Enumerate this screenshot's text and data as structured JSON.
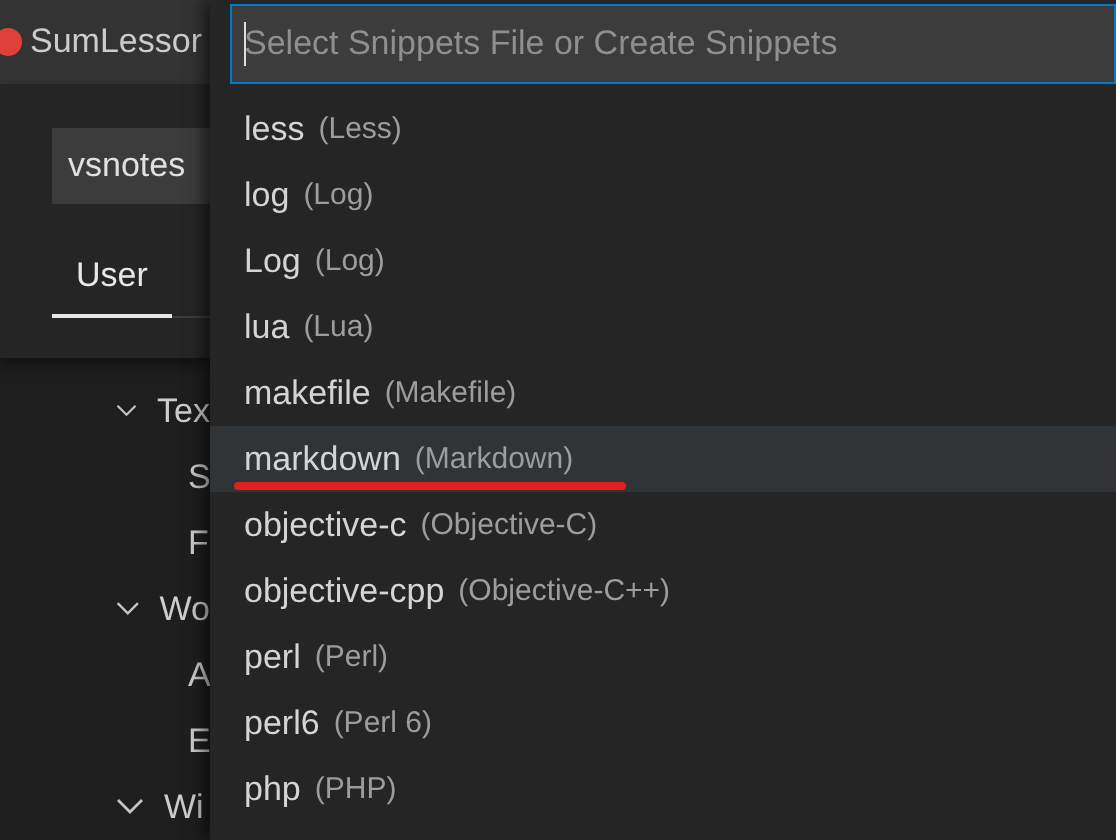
{
  "title_bar": {
    "title": "SumLessor"
  },
  "settings": {
    "search": {
      "value": "vsnotes"
    },
    "tabs": [
      {
        "label": "User",
        "selected": true
      }
    ],
    "tree": [
      {
        "label": "Tex",
        "expanded": true,
        "children": [
          {
            "label": "S"
          },
          {
            "label": "F"
          }
        ]
      },
      {
        "label": "Wo",
        "expanded": true,
        "children": [
          {
            "label": "A"
          },
          {
            "label": "E"
          }
        ]
      },
      {
        "label": "Wi",
        "expanded": true
      }
    ]
  },
  "quick_pick": {
    "placeholder": "Select Snippets File or Create Snippets",
    "items": [
      {
        "label": "less",
        "description": "(Less)",
        "selected": false,
        "annotated": false
      },
      {
        "label": "log",
        "description": "(Log)",
        "selected": false,
        "annotated": false
      },
      {
        "label": "Log",
        "description": "(Log)",
        "selected": false,
        "annotated": false
      },
      {
        "label": "lua",
        "description": "(Lua)",
        "selected": false,
        "annotated": false
      },
      {
        "label": "makefile",
        "description": "(Makefile)",
        "selected": false,
        "annotated": false
      },
      {
        "label": "markdown",
        "description": "(Markdown)",
        "selected": true,
        "annotated": true
      },
      {
        "label": "objective-c",
        "description": "(Objective-C)",
        "selected": false,
        "annotated": false
      },
      {
        "label": "objective-cpp",
        "description": "(Objective-C++)",
        "selected": false,
        "annotated": false
      },
      {
        "label": "perl",
        "description": "(Perl)",
        "selected": false,
        "annotated": false
      },
      {
        "label": "perl6",
        "description": "(Perl 6)",
        "selected": false,
        "annotated": false
      },
      {
        "label": "php",
        "description": "(PHP)",
        "selected": false,
        "annotated": false
      }
    ]
  }
}
